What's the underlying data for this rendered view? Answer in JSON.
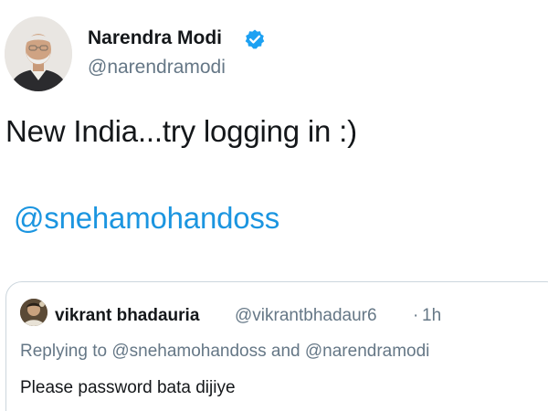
{
  "tweet": {
    "author_name": "Narendra Modi",
    "author_handle": "@narendramodi",
    "verified_icon": "verified-badge-icon",
    "text": "New India...try logging in :)",
    "mention": "@snehamohandoss",
    "link_color": "#1b95e0"
  },
  "quoted_tweet": {
    "author_name": "vikrant bhadauria",
    "author_handle": "@vikrantbhadaur6",
    "separator": "·",
    "time": "1h",
    "replying_to": "Replying to @snehamohandoss and @narendramodi",
    "text": "Please password bata dijiye"
  }
}
